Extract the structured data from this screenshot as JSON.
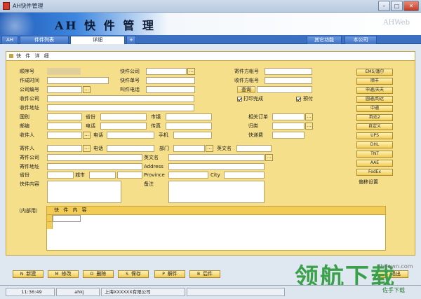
{
  "window": {
    "title": "AH快件管理"
  },
  "banner": {
    "logo": "AH 快 件 管 理",
    "brand": "AHWeb"
  },
  "tabs": {
    "t0": "AH",
    "t1": "件件列表",
    "t2": "详细",
    "t3": "+",
    "t4": "其它功能",
    "t5": "本公司"
  },
  "panel": {
    "title": "快 件 详 细"
  },
  "labels": {
    "seq": "顺序号",
    "op_time": "作成时间",
    "comp_code": "公司编号",
    "recv_comp": "收件公司",
    "recv_addr": "收件地址",
    "country": "国别",
    "province": "省份",
    "city": "市镇",
    "mail": "邮编",
    "tel": "电话",
    "fax": "传真",
    "recipient": "收件人",
    "phone": "电话",
    "mobile": "手机",
    "express_comp": "快件公司",
    "express_no": "快件单号",
    "call_tel": "叫件电话",
    "sender_acct": "寄件方帐号",
    "recv_acct": "收件方帐号",
    "query": "查询",
    "print_done": "打印完成",
    "prepaid": "预付",
    "related_order": "相关订单",
    "category": "归类",
    "express_fee": "快递费",
    "sender": "寄件人",
    "s_phone": "电话",
    "dept": "部门",
    "en_name": "英文名",
    "send_comp": "寄件公司",
    "en_name2": "英文名",
    "send_addr": "寄件地址",
    "address": "Address",
    "s_province": "省份",
    "s_city": "城市",
    "province_en": "Province",
    "city_en": "City",
    "content": "快件内容",
    "note": "备注",
    "internal": "（内部用）",
    "inner_title": "快 件 内 容",
    "move_setting": "偏移设置"
  },
  "carriers": [
    "EMS/潘尔",
    "顺丰",
    "申通/天天",
    "圆通/韵达",
    "中通",
    "韵达2",
    "自定义",
    "UPS",
    "DHL",
    "TNT",
    "AAE",
    "FedEx"
  ],
  "actions": {
    "new": "新建",
    "edit": "修改",
    "delete": "删除",
    "save": "保存",
    "parts": "解件",
    "next": "后件",
    "exit": "退出"
  },
  "action_keys": {
    "new": "N",
    "edit": "M",
    "delete": "D",
    "save": "S",
    "parts": "P",
    "next": "B",
    "exit": "X"
  },
  "status": {
    "time": "11:36:49",
    "user": "ahkj",
    "company": "上海XXXXXX有限公司"
  },
  "watermark": {
    "main": "领航下载",
    "site": "ihdown.com",
    "tail": "佐手下载"
  },
  "colors": {
    "panel": "#f6df8a",
    "accent": "#f2cc55",
    "banner": "#1f5bb8"
  }
}
